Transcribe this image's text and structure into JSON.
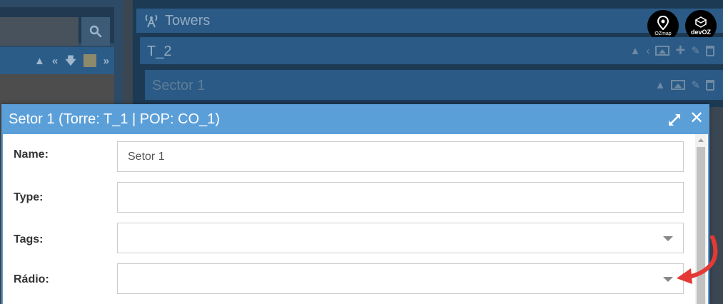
{
  "left_panel": {
    "search": {
      "placeholder": ""
    }
  },
  "towers": {
    "title": "Towers",
    "tower": {
      "name": "T_2"
    },
    "sector": {
      "name": "Sector 1"
    }
  },
  "logos": {
    "ozmap": "OZmap",
    "devoz_prefix": "dev",
    "devoz_suffix": "OZ"
  },
  "modal": {
    "title": "Setor 1 (Torre: T_1 | POP: CO_1)",
    "fields": {
      "name": {
        "label": "Name:",
        "value": "Setor 1"
      },
      "type": {
        "label": "Type:",
        "value": ""
      },
      "tags": {
        "label": "Tags:",
        "value": ""
      },
      "radio": {
        "label": "Rádio:",
        "value": ""
      }
    }
  },
  "colors": {
    "modal_header": "#5b9fd9",
    "panel_header": "#2a5a85",
    "annotation_arrow": "#e53935"
  }
}
